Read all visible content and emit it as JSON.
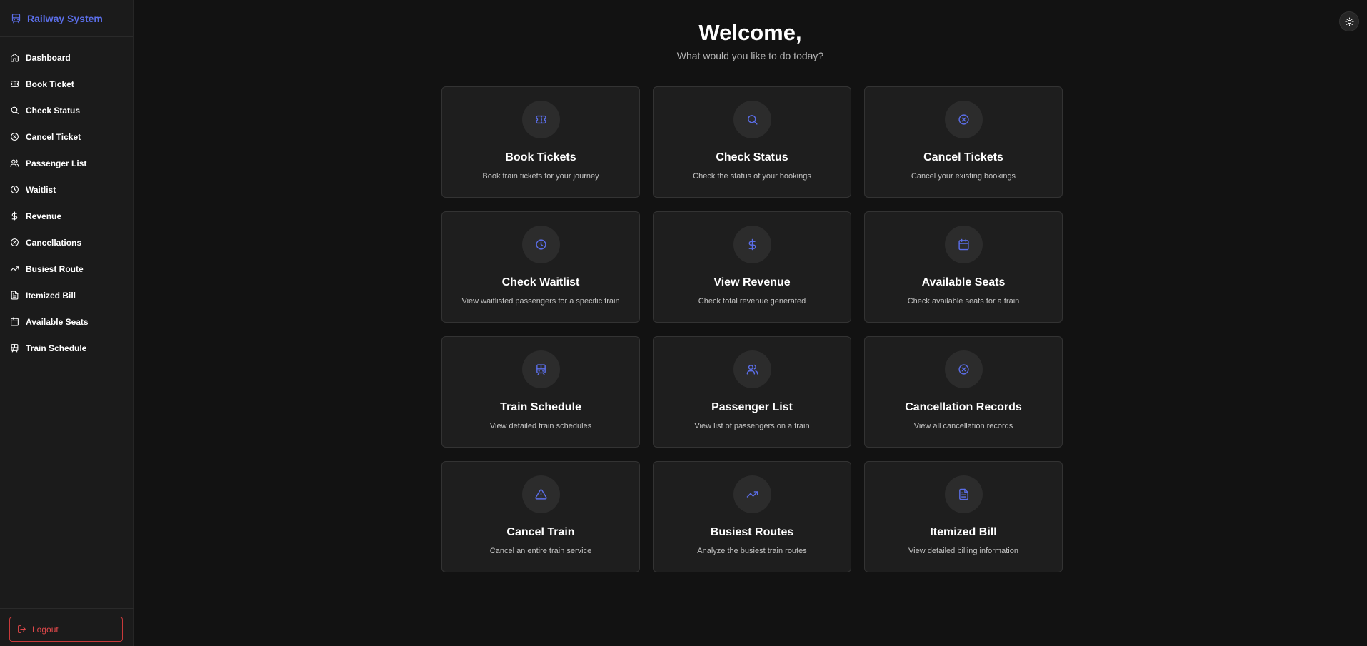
{
  "app": {
    "title": "Railway System",
    "icon": "train-icon",
    "accent": "#5b6ee8"
  },
  "sidebar": {
    "items": [
      {
        "label": "Dashboard",
        "icon": "home-icon"
      },
      {
        "label": "Book Ticket",
        "icon": "ticket-icon"
      },
      {
        "label": "Check Status",
        "icon": "search-icon"
      },
      {
        "label": "Cancel Ticket",
        "icon": "x-circle-icon"
      },
      {
        "label": "Passenger List",
        "icon": "users-icon"
      },
      {
        "label": "Waitlist",
        "icon": "clock-icon"
      },
      {
        "label": "Revenue",
        "icon": "dollar-icon"
      },
      {
        "label": "Cancellations",
        "icon": "x-circle-icon"
      },
      {
        "label": "Busiest Route",
        "icon": "trending-up-icon"
      },
      {
        "label": "Itemized Bill",
        "icon": "file-text-icon"
      },
      {
        "label": "Available Seats",
        "icon": "calendar-icon"
      },
      {
        "label": "Train Schedule",
        "icon": "train-icon"
      }
    ],
    "logout": {
      "label": "Logout",
      "icon": "logout-icon",
      "color": "#e0484a"
    }
  },
  "header": {
    "title": "Welcome,",
    "subtitle": "What would you like to do today?"
  },
  "theme_toggle": {
    "icon": "sun-icon"
  },
  "cards": [
    {
      "title": "Book Tickets",
      "desc": "Book train tickets for your journey",
      "icon": "ticket-icon"
    },
    {
      "title": "Check Status",
      "desc": "Check the status of your bookings",
      "icon": "search-icon"
    },
    {
      "title": "Cancel Tickets",
      "desc": "Cancel your existing bookings",
      "icon": "x-circle-icon"
    },
    {
      "title": "Check Waitlist",
      "desc": "View waitlisted passengers for a specific train",
      "icon": "clock-icon"
    },
    {
      "title": "View Revenue",
      "desc": "Check total revenue generated",
      "icon": "dollar-icon"
    },
    {
      "title": "Available Seats",
      "desc": "Check available seats for a train",
      "icon": "calendar-icon"
    },
    {
      "title": "Train Schedule",
      "desc": "View detailed train schedules",
      "icon": "train-icon"
    },
    {
      "title": "Passenger List",
      "desc": "View list of passengers on a train",
      "icon": "users-icon"
    },
    {
      "title": "Cancellation Records",
      "desc": "View all cancellation records",
      "icon": "x-circle-icon"
    },
    {
      "title": "Cancel Train",
      "desc": "Cancel an entire train service",
      "icon": "alert-triangle-icon"
    },
    {
      "title": "Busiest Routes",
      "desc": "Analyze the busiest train routes",
      "icon": "trending-up-icon"
    },
    {
      "title": "Itemized Bill",
      "desc": "View detailed billing information",
      "icon": "file-text-icon"
    }
  ]
}
